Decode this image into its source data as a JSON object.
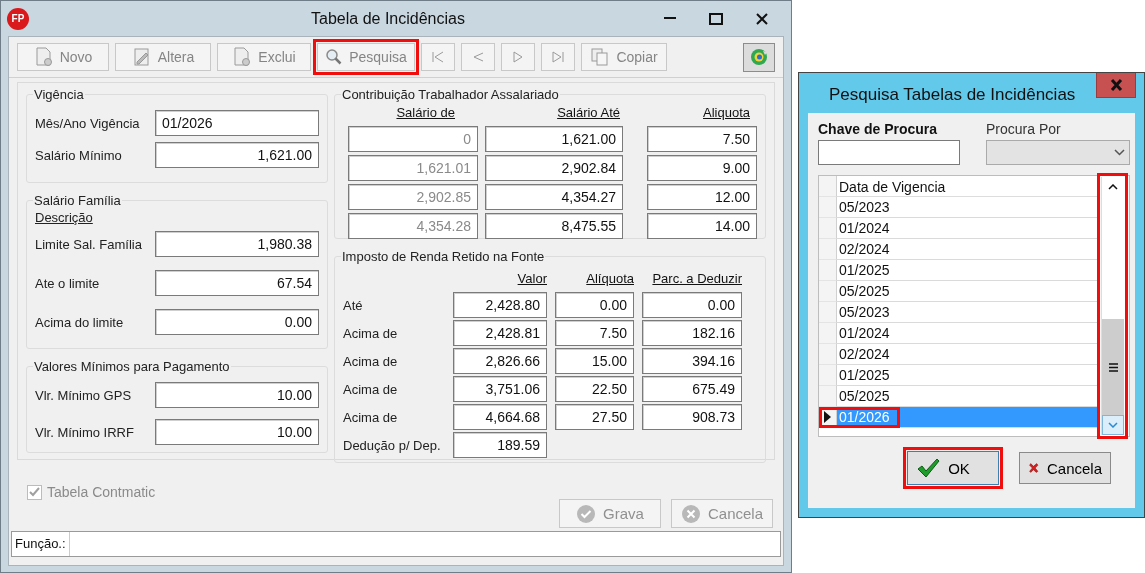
{
  "main_window": {
    "logo": "FP",
    "title": "Tabela de Incidências",
    "toolbar": [
      {
        "kind": "new",
        "label": "Novo",
        "highlighted": false
      },
      {
        "kind": "edit",
        "label": "Altera",
        "highlighted": false
      },
      {
        "kind": "delete",
        "label": "Exclui",
        "highlighted": false
      },
      {
        "kind": "search",
        "label": "Pesquisa",
        "highlighted": true
      },
      {
        "kind": "first",
        "highlighted": false
      },
      {
        "kind": "prev",
        "highlighted": false
      },
      {
        "kind": "next",
        "highlighted": false
      },
      {
        "kind": "last",
        "highlighted": false
      },
      {
        "kind": "copy",
        "label": "Copiar",
        "highlighted": false
      },
      {
        "kind": "refresh"
      }
    ],
    "vigencia": {
      "title": "Vigência",
      "fields": [
        {
          "label": "Mês/Ano Vigência",
          "value": "01/2026",
          "kind": "text"
        },
        {
          "label": "Salário Mínimo",
          "value": "1,621.00",
          "kind": "number"
        }
      ]
    },
    "salario_familia": {
      "title": "Salário Família",
      "subtitle": "Descrição",
      "fields": [
        {
          "label": "Limite Sal. Família",
          "value": "1,980.38",
          "kind": "number"
        },
        {
          "label": "Ate o limite",
          "value": "67.54",
          "kind": "number"
        },
        {
          "label": "Acima do limite",
          "value": "0.00",
          "kind": "number"
        }
      ]
    },
    "valores_minimos": {
      "title": "Valores Mínimos para Pagamento",
      "fields": [
        {
          "label": "Vlr. Mínimo GPS",
          "value": "10.00",
          "kind": "number"
        },
        {
          "label": "Vlr. Mínimo IRRF",
          "value": "10.00",
          "kind": "number"
        }
      ]
    },
    "contribuicao": {
      "title": "Contribuição Trabalhador Assalariado",
      "columns": [
        "Salário de",
        "Salário Até",
        "Aliquota"
      ],
      "rows": [
        {
          "cells": [
            {
              "value": "0",
              "disabled": true
            },
            {
              "value": "1,621.00",
              "disabled": false
            },
            {
              "value": "7.50",
              "disabled": false
            }
          ]
        },
        {
          "cells": [
            {
              "value": "1,621.01",
              "disabled": true
            },
            {
              "value": "2,902.84",
              "disabled": false
            },
            {
              "value": "9.00",
              "disabled": false
            }
          ]
        },
        {
          "cells": [
            {
              "value": "2,902.85",
              "disabled": true
            },
            {
              "value": "4,354.27",
              "disabled": false
            },
            {
              "value": "12.00",
              "disabled": false
            }
          ]
        },
        {
          "cells": [
            {
              "value": "4,354.28",
              "disabled": true
            },
            {
              "value": "8,475.55",
              "disabled": false
            },
            {
              "value": "14.00",
              "disabled": false
            }
          ]
        }
      ]
    },
    "imposto_renda": {
      "title": "Imposto de Renda Retido na Fonte",
      "columns": [
        "Valor",
        "Alíquota",
        "Parc. a Deduzir"
      ],
      "rows": [
        {
          "label": "Até",
          "cells": [
            "2,428.80",
            "0.00",
            "0.00"
          ]
        },
        {
          "label": "Acima de",
          "cells": [
            "2,428.81",
            "7.50",
            "182.16"
          ]
        },
        {
          "label": "Acima de",
          "cells": [
            "2,826.66",
            "15.00",
            "394.16"
          ]
        },
        {
          "label": "Acima de",
          "cells": [
            "3,751.06",
            "22.50",
            "675.49"
          ]
        },
        {
          "label": "Acima de",
          "cells": [
            "4,664.68",
            "27.50",
            "908.73"
          ]
        }
      ],
      "deduction": {
        "label": "Dedução p/ Dep.",
        "value": "189.59"
      }
    },
    "tabela_contmatic": {
      "label": "Tabela Contmatic",
      "checked": true,
      "disabled": true
    },
    "actions": [
      {
        "kind": "save",
        "label": "Grava",
        "disabled": true
      },
      {
        "kind": "cancel",
        "label": "Cancela",
        "disabled": true
      }
    ],
    "function_bar": {
      "label": "Função.:"
    }
  },
  "search_dialog": {
    "title": "Pesquisa Tabelas de Incidências",
    "key_label": "Chave de Procura",
    "search_by_label": "Procura Por",
    "grid": {
      "column": "Data de Vigencia",
      "scrollbar_highlighted": true,
      "rows": [
        {
          "value": "05/2023",
          "selected": false,
          "highlighted": false
        },
        {
          "value": "01/2024",
          "selected": false,
          "highlighted": false
        },
        {
          "value": "02/2024",
          "selected": false,
          "highlighted": false
        },
        {
          "value": "01/2025",
          "selected": false,
          "highlighted": false
        },
        {
          "value": "05/2025",
          "selected": false,
          "highlighted": false
        },
        {
          "value": "05/2023",
          "selected": false,
          "highlighted": false
        },
        {
          "value": "01/2024",
          "selected": false,
          "highlighted": false
        },
        {
          "value": "02/2024",
          "selected": false,
          "highlighted": false
        },
        {
          "value": "01/2025",
          "selected": false,
          "highlighted": false
        },
        {
          "value": "05/2025",
          "selected": false,
          "highlighted": false
        },
        {
          "value": "01/2026",
          "selected": true,
          "highlighted": true
        }
      ]
    },
    "buttons": [
      {
        "kind": "ok",
        "label": "OK",
        "highlighted": true
      },
      {
        "kind": "cancel",
        "label": "Cancela",
        "highlighted": false
      }
    ]
  }
}
